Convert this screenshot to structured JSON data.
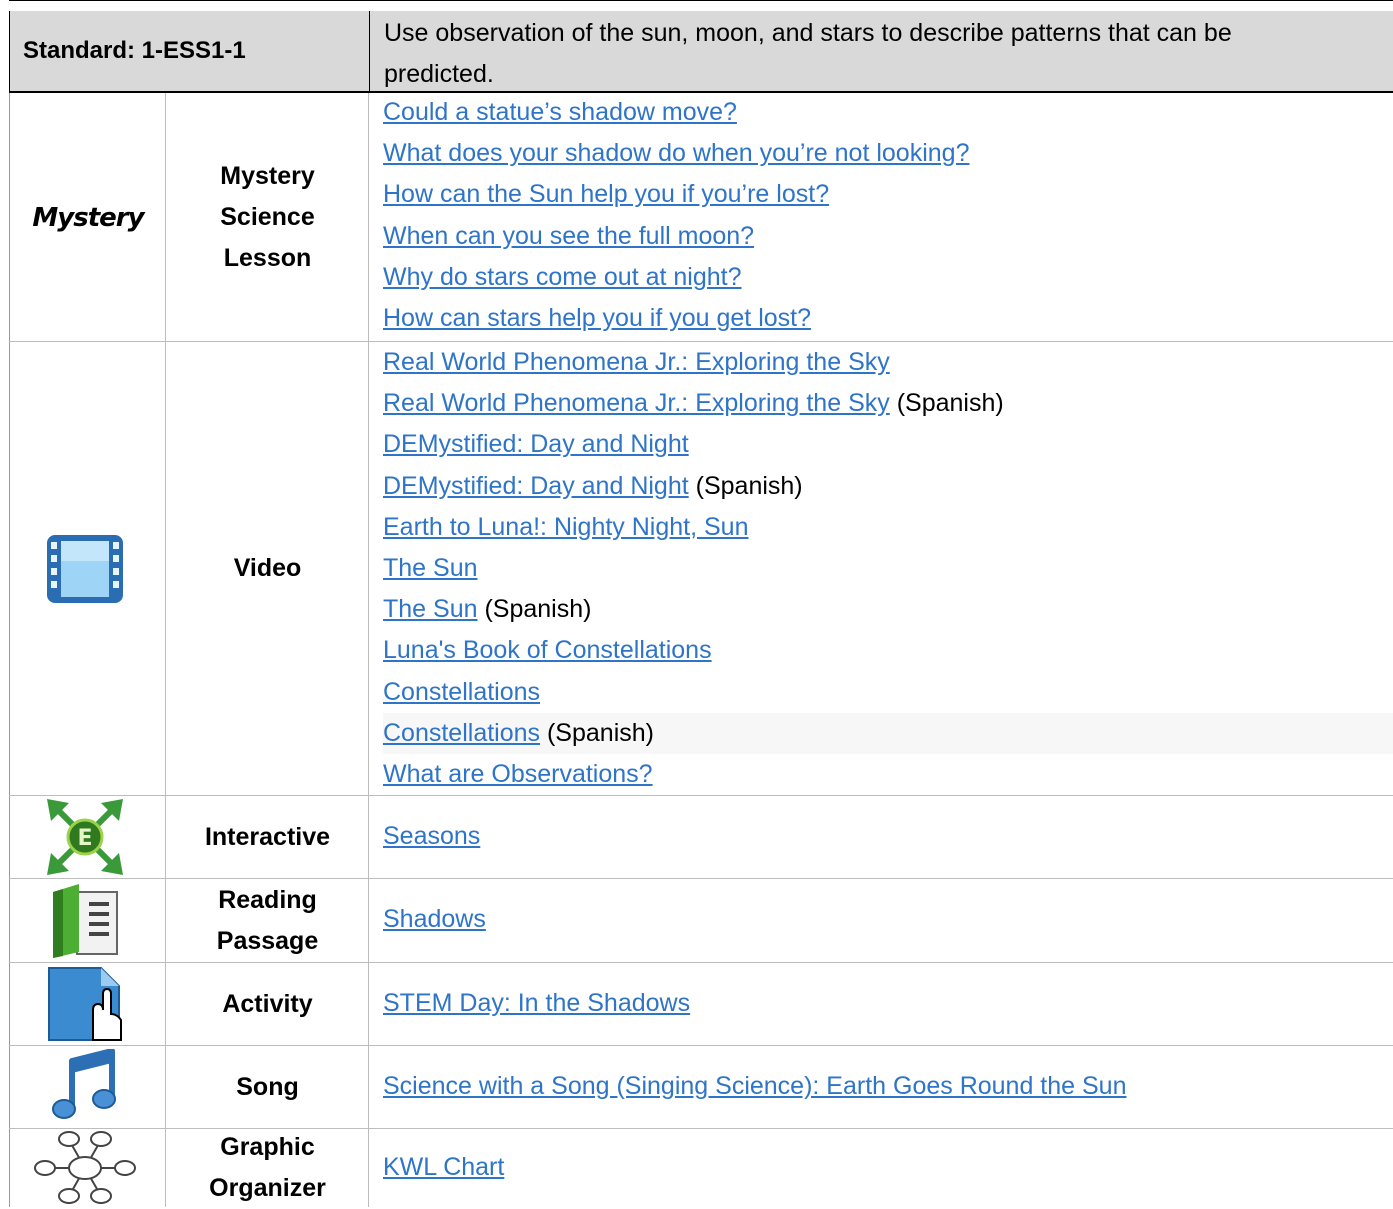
{
  "standard": {
    "label": "Standard: 1-ESS1-1",
    "description_line1": "Use observation of the sun, moon, and stars to describe patterns that can be",
    "description_line2": "predicted."
  },
  "sections": {
    "mystery": {
      "logo_text": "Mystery",
      "category": [
        "Mystery",
        "Science",
        "Lesson"
      ],
      "links": [
        "Could a statue’s shadow move?",
        "What does your shadow do when you’re not looking?",
        "How can the Sun help you if you’re lost?",
        "When can you see the full moon?",
        "Why do stars come out at night?",
        "How can stars help you if you get lost?"
      ]
    },
    "video": {
      "icon": "film-icon",
      "category": "Video",
      "links": [
        {
          "text": "Real World Phenomena Jr.: Exploring the Sky",
          "note": ""
        },
        {
          "text": "Real World Phenomena Jr.: Exploring the Sky",
          "note": " (Spanish)"
        },
        {
          "text": "DEMystified: Day and Night",
          "note": ""
        },
        {
          "text": "DEMystified: Day and Night",
          "note": " (Spanish)"
        },
        {
          "text": "Earth to Luna!: Nighty Night, Sun",
          "note": ""
        },
        {
          "text": "The Sun",
          "note": ""
        },
        {
          "text": "The Sun",
          "note": " (Spanish)"
        },
        {
          "text": "Luna's Book of Constellations",
          "note": ""
        },
        {
          "text": "Constellations",
          "note": ""
        },
        {
          "text": "Constellations",
          "note": " (Spanish)"
        },
        {
          "text": "What are Observations?",
          "note": ""
        }
      ]
    },
    "interactive": {
      "icon": "explore-arrows-icon",
      "icon_letter": "E",
      "category": "Interactive",
      "link": "Seasons"
    },
    "reading": {
      "icon": "book-icon",
      "category": [
        "Reading",
        "Passage"
      ],
      "link": "Shadows"
    },
    "activity": {
      "icon": "hand-pointer-icon",
      "category": "Activity",
      "link": "STEM Day: In the Shadows"
    },
    "song": {
      "icon": "music-note-icon",
      "category": "Song",
      "link": "Science with a Song (Singing Science): Earth Goes Round the Sun"
    },
    "organizer": {
      "icon": "mind-map-icon",
      "category": [
        "Graphic",
        "Organizer"
      ],
      "link": "KWL Chart"
    }
  },
  "colors": {
    "link": "#2e74c8",
    "header_bg": "#d9d9d9",
    "grid": "#bdbdbd"
  }
}
